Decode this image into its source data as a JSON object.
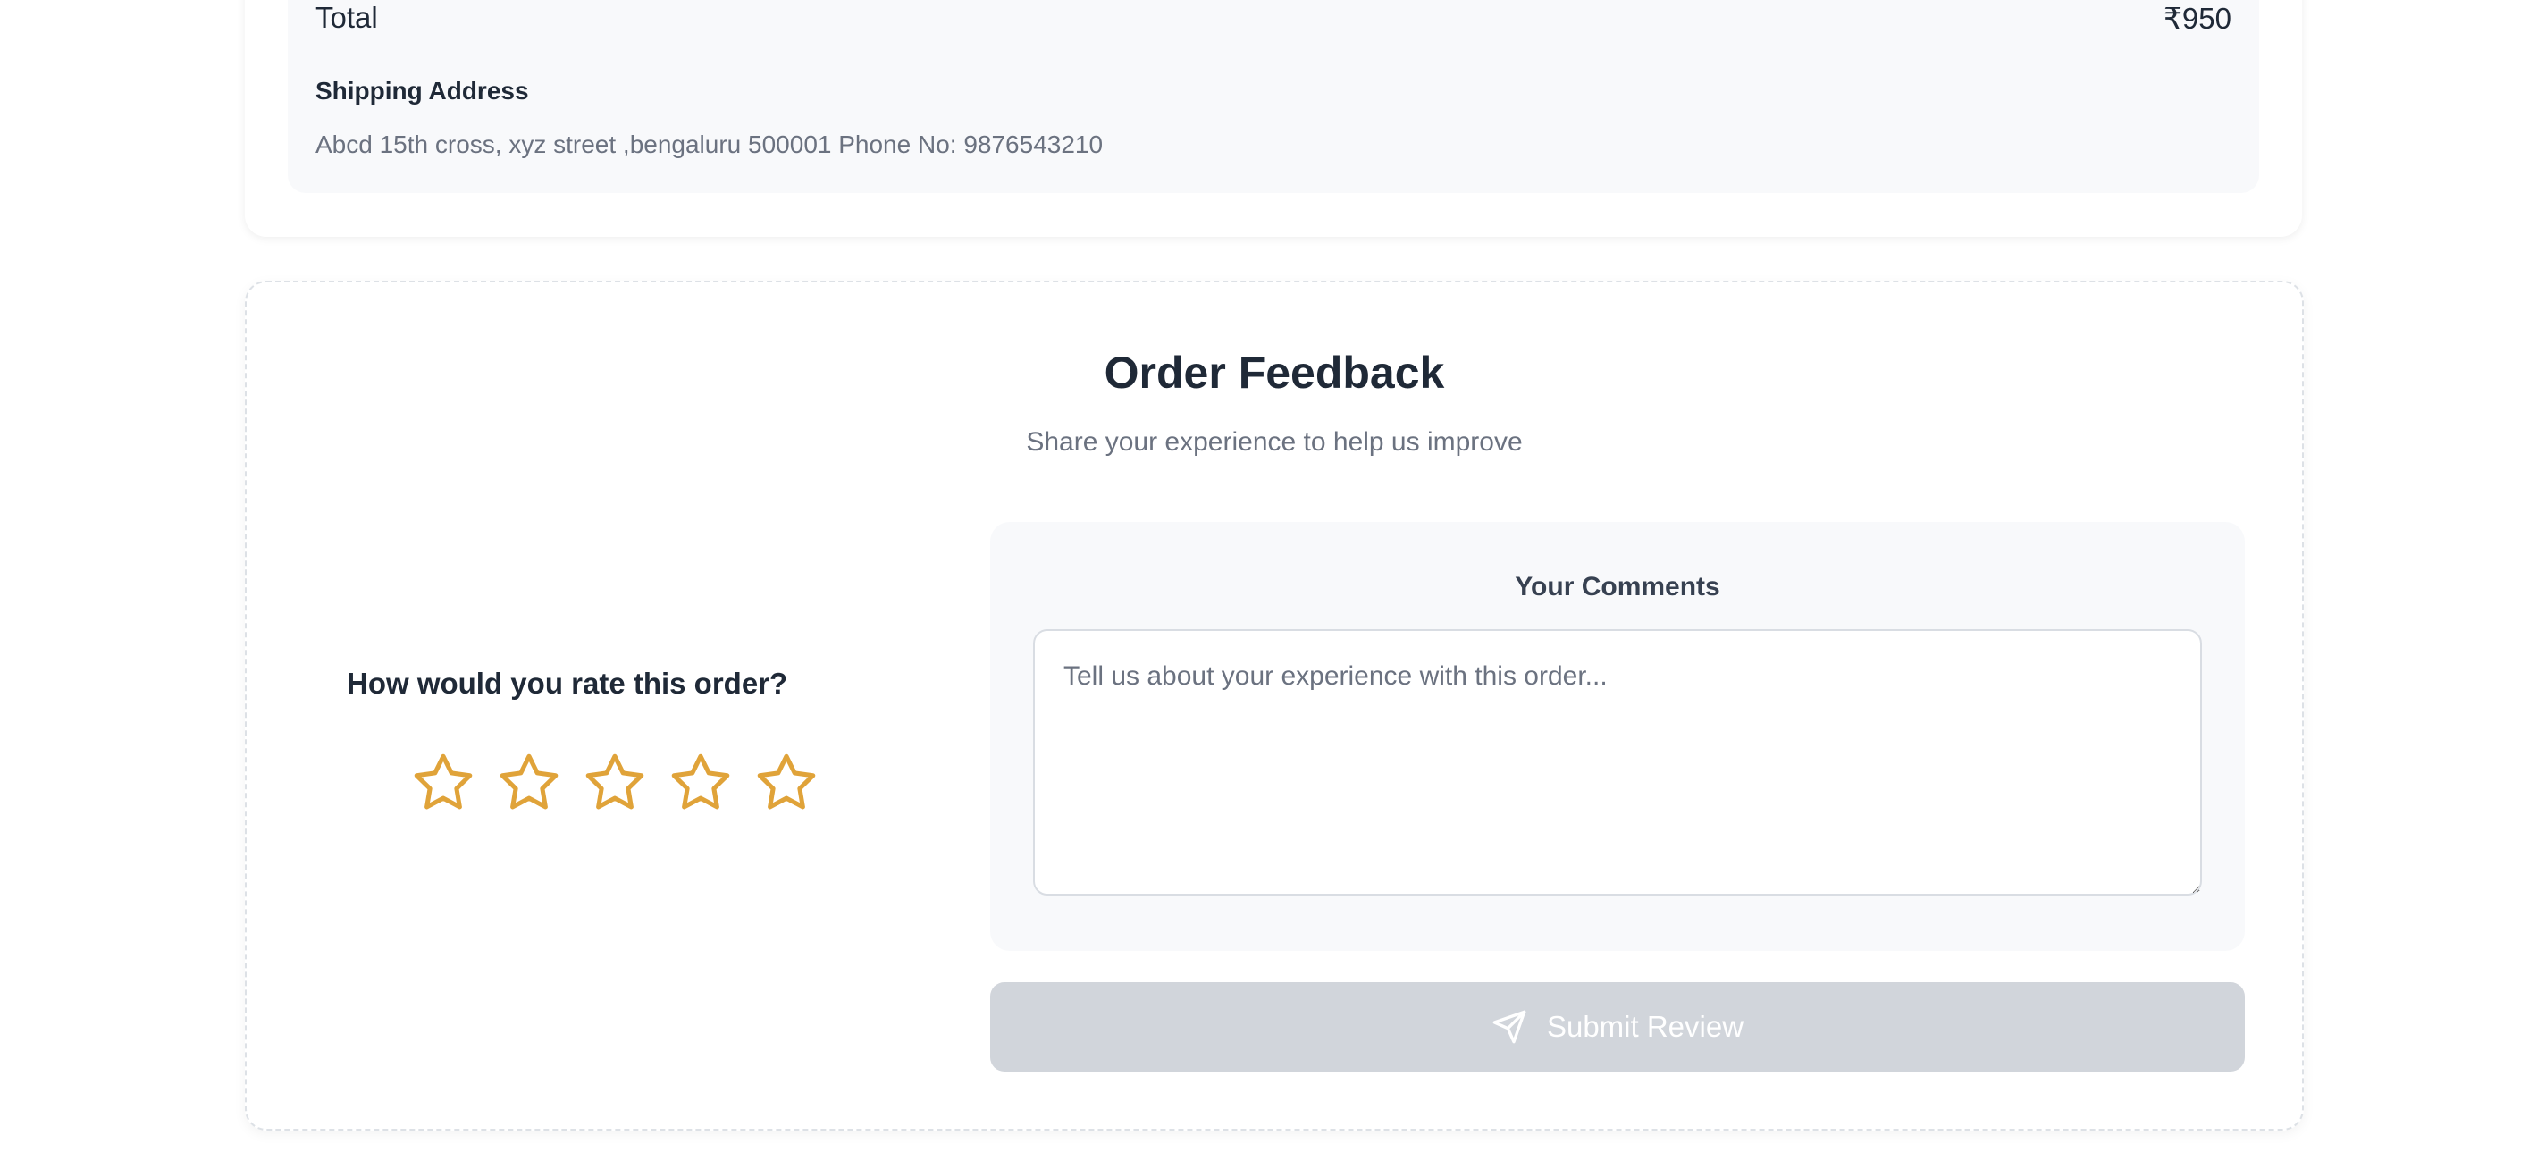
{
  "order_summary": {
    "total_label": "Total",
    "total_value": "₹950",
    "shipping_heading": "Shipping Address",
    "shipping_address": "Abcd 15th cross, xyz street ,bengaluru 500001 Phone No: 9876543210"
  },
  "feedback": {
    "title": "Order Feedback",
    "subtitle": "Share your experience to help us improve",
    "rating_question": "How would you rate this order?",
    "rating": {
      "value": 0,
      "max": 5,
      "star_icon": "star-outline-icon",
      "star_color": "#e0a339"
    },
    "comments_label": "Your Comments",
    "comments_value": "",
    "comments_placeholder": "Tell us about your experience with this order...",
    "submit_label": "Submit Review",
    "submit_icon": "send-icon",
    "submit_disabled": true
  }
}
